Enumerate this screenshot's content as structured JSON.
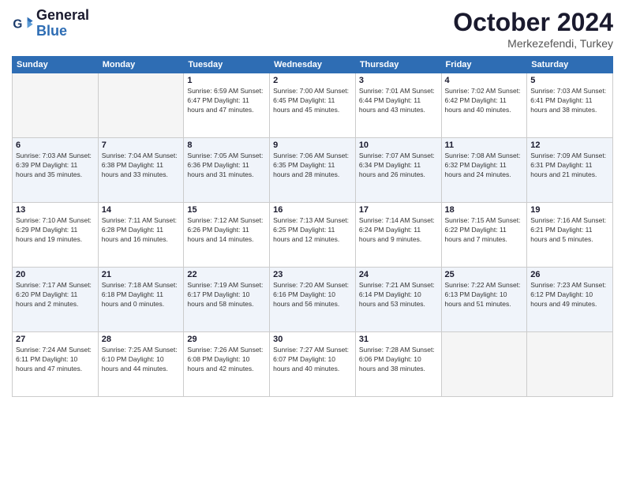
{
  "header": {
    "logo_line1": "General",
    "logo_line2": "Blue",
    "month": "October 2024",
    "location": "Merkezefendi, Turkey"
  },
  "weekdays": [
    "Sunday",
    "Monday",
    "Tuesday",
    "Wednesday",
    "Thursday",
    "Friday",
    "Saturday"
  ],
  "weeks": [
    [
      {
        "day": "",
        "detail": ""
      },
      {
        "day": "",
        "detail": ""
      },
      {
        "day": "1",
        "detail": "Sunrise: 6:59 AM\nSunset: 6:47 PM\nDaylight: 11 hours and 47 minutes."
      },
      {
        "day": "2",
        "detail": "Sunrise: 7:00 AM\nSunset: 6:45 PM\nDaylight: 11 hours and 45 minutes."
      },
      {
        "day": "3",
        "detail": "Sunrise: 7:01 AM\nSunset: 6:44 PM\nDaylight: 11 hours and 43 minutes."
      },
      {
        "day": "4",
        "detail": "Sunrise: 7:02 AM\nSunset: 6:42 PM\nDaylight: 11 hours and 40 minutes."
      },
      {
        "day": "5",
        "detail": "Sunrise: 7:03 AM\nSunset: 6:41 PM\nDaylight: 11 hours and 38 minutes."
      }
    ],
    [
      {
        "day": "6",
        "detail": "Sunrise: 7:03 AM\nSunset: 6:39 PM\nDaylight: 11 hours and 35 minutes."
      },
      {
        "day": "7",
        "detail": "Sunrise: 7:04 AM\nSunset: 6:38 PM\nDaylight: 11 hours and 33 minutes."
      },
      {
        "day": "8",
        "detail": "Sunrise: 7:05 AM\nSunset: 6:36 PM\nDaylight: 11 hours and 31 minutes."
      },
      {
        "day": "9",
        "detail": "Sunrise: 7:06 AM\nSunset: 6:35 PM\nDaylight: 11 hours and 28 minutes."
      },
      {
        "day": "10",
        "detail": "Sunrise: 7:07 AM\nSunset: 6:34 PM\nDaylight: 11 hours and 26 minutes."
      },
      {
        "day": "11",
        "detail": "Sunrise: 7:08 AM\nSunset: 6:32 PM\nDaylight: 11 hours and 24 minutes."
      },
      {
        "day": "12",
        "detail": "Sunrise: 7:09 AM\nSunset: 6:31 PM\nDaylight: 11 hours and 21 minutes."
      }
    ],
    [
      {
        "day": "13",
        "detail": "Sunrise: 7:10 AM\nSunset: 6:29 PM\nDaylight: 11 hours and 19 minutes."
      },
      {
        "day": "14",
        "detail": "Sunrise: 7:11 AM\nSunset: 6:28 PM\nDaylight: 11 hours and 16 minutes."
      },
      {
        "day": "15",
        "detail": "Sunrise: 7:12 AM\nSunset: 6:26 PM\nDaylight: 11 hours and 14 minutes."
      },
      {
        "day": "16",
        "detail": "Sunrise: 7:13 AM\nSunset: 6:25 PM\nDaylight: 11 hours and 12 minutes."
      },
      {
        "day": "17",
        "detail": "Sunrise: 7:14 AM\nSunset: 6:24 PM\nDaylight: 11 hours and 9 minutes."
      },
      {
        "day": "18",
        "detail": "Sunrise: 7:15 AM\nSunset: 6:22 PM\nDaylight: 11 hours and 7 minutes."
      },
      {
        "day": "19",
        "detail": "Sunrise: 7:16 AM\nSunset: 6:21 PM\nDaylight: 11 hours and 5 minutes."
      }
    ],
    [
      {
        "day": "20",
        "detail": "Sunrise: 7:17 AM\nSunset: 6:20 PM\nDaylight: 11 hours and 2 minutes."
      },
      {
        "day": "21",
        "detail": "Sunrise: 7:18 AM\nSunset: 6:18 PM\nDaylight: 11 hours and 0 minutes."
      },
      {
        "day": "22",
        "detail": "Sunrise: 7:19 AM\nSunset: 6:17 PM\nDaylight: 10 hours and 58 minutes."
      },
      {
        "day": "23",
        "detail": "Sunrise: 7:20 AM\nSunset: 6:16 PM\nDaylight: 10 hours and 56 minutes."
      },
      {
        "day": "24",
        "detail": "Sunrise: 7:21 AM\nSunset: 6:14 PM\nDaylight: 10 hours and 53 minutes."
      },
      {
        "day": "25",
        "detail": "Sunrise: 7:22 AM\nSunset: 6:13 PM\nDaylight: 10 hours and 51 minutes."
      },
      {
        "day": "26",
        "detail": "Sunrise: 7:23 AM\nSunset: 6:12 PM\nDaylight: 10 hours and 49 minutes."
      }
    ],
    [
      {
        "day": "27",
        "detail": "Sunrise: 7:24 AM\nSunset: 6:11 PM\nDaylight: 10 hours and 47 minutes."
      },
      {
        "day": "28",
        "detail": "Sunrise: 7:25 AM\nSunset: 6:10 PM\nDaylight: 10 hours and 44 minutes."
      },
      {
        "day": "29",
        "detail": "Sunrise: 7:26 AM\nSunset: 6:08 PM\nDaylight: 10 hours and 42 minutes."
      },
      {
        "day": "30",
        "detail": "Sunrise: 7:27 AM\nSunset: 6:07 PM\nDaylight: 10 hours and 40 minutes."
      },
      {
        "day": "31",
        "detail": "Sunrise: 7:28 AM\nSunset: 6:06 PM\nDaylight: 10 hours and 38 minutes."
      },
      {
        "day": "",
        "detail": ""
      },
      {
        "day": "",
        "detail": ""
      }
    ]
  ]
}
